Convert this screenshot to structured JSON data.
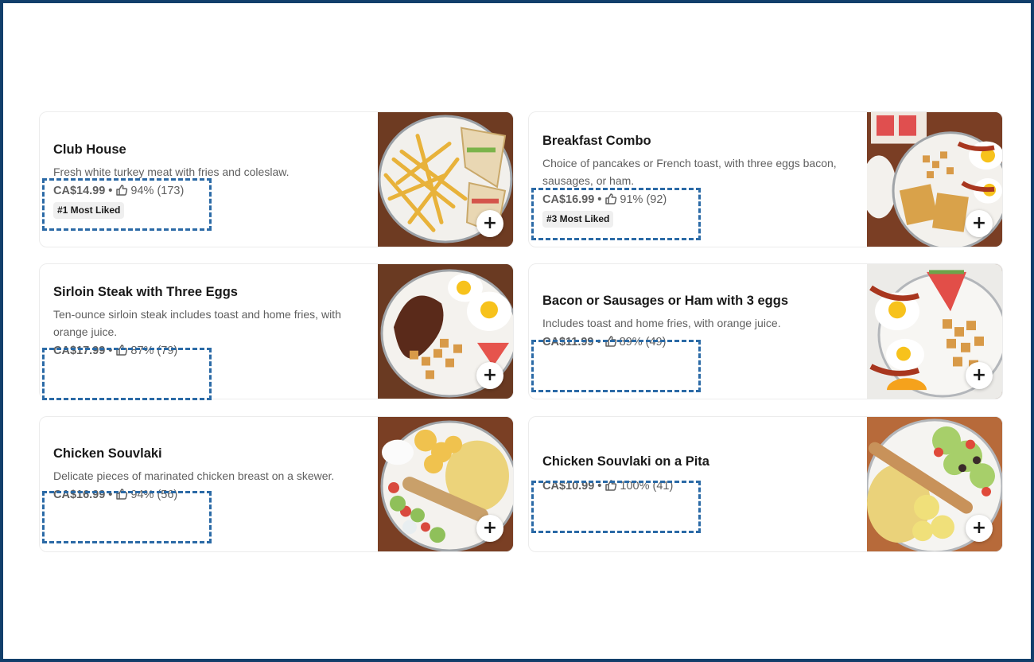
{
  "items": [
    {
      "title": "Club House",
      "description": "Fresh white turkey meat with fries and coleslaw.",
      "price": "CA$14.99",
      "rating": "94%",
      "reviews": "(173)",
      "badge": "#1 Most Liked",
      "add_label": "+",
      "photo_icon": "club-house-sandwich-photo"
    },
    {
      "title": "Breakfast Combo",
      "description": "Choice of pancakes or French toast, with three eggs bacon, sausages, or ham.",
      "price": "CA$16.99",
      "rating": "91%",
      "reviews": "(92)",
      "badge": "#3 Most Liked",
      "add_label": "+",
      "photo_icon": "breakfast-combo-photo"
    },
    {
      "title": "Sirloin Steak with Three Eggs",
      "description": "Ten-ounce sirloin steak includes toast and home fries, with orange juice.",
      "price": "CA$17.99",
      "rating": "87%",
      "reviews": "(79)",
      "badge": "",
      "add_label": "+",
      "photo_icon": "steak-and-eggs-photo"
    },
    {
      "title": "Bacon or Sausages or Ham with 3 eggs",
      "description": "Includes toast and home fries, with orange juice.",
      "price": "CA$11.99",
      "rating": "89%",
      "reviews": "(49)",
      "badge": "",
      "add_label": "+",
      "photo_icon": "bacon-and-eggs-photo"
    },
    {
      "title": "Chicken Souvlaki",
      "description": "Delicate pieces of marinated chicken breast on a skewer.",
      "price": "CA$16.99",
      "rating": "94%",
      "reviews": "(56)",
      "badge": "",
      "add_label": "+",
      "photo_icon": "chicken-souvlaki-photo"
    },
    {
      "title": "Chicken Souvlaki on a Pita",
      "description": "",
      "price": "CA$10.99",
      "rating": "100%",
      "reviews": "(41)",
      "badge": "",
      "add_label": "+",
      "photo_icon": "souvlaki-pita-photo"
    }
  ],
  "separator": "•",
  "colors": {
    "frame_border": "#123f6b",
    "highlight_dash": "#2b6aa6",
    "badge_bg": "#efefef",
    "text_primary": "#191919",
    "text_secondary": "#5f5f5f"
  }
}
